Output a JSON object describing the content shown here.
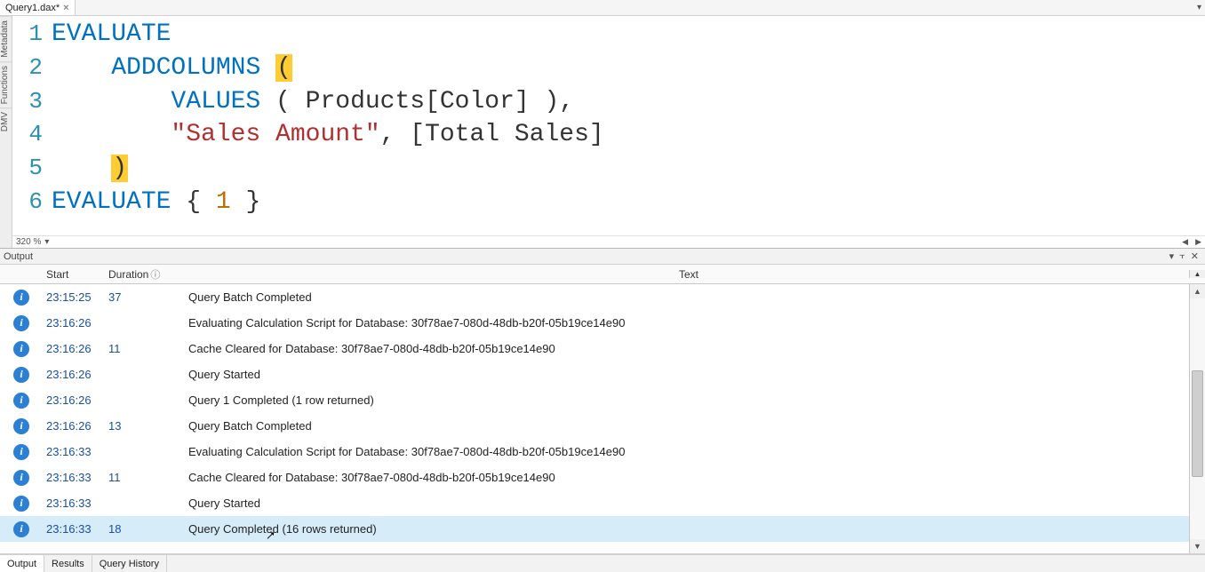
{
  "tabs": {
    "file": "Query1.dax*",
    "close_glyph": "×"
  },
  "side_panels": [
    "Metadata",
    "Functions",
    "DMV"
  ],
  "editor": {
    "zoom_label": "320 %",
    "lines": [
      {
        "n": 1,
        "tokens": [
          {
            "t": "EVALUATE",
            "c": "tok-kw"
          }
        ]
      },
      {
        "n": 2,
        "tokens": [
          {
            "t": "    ",
            "c": ""
          },
          {
            "t": "ADDCOLUMNS",
            "c": "tok-func"
          },
          {
            "t": " ",
            "c": ""
          },
          {
            "t": "(",
            "c": "tok-paren-hi"
          }
        ]
      },
      {
        "n": 3,
        "tokens": [
          {
            "t": "        ",
            "c": ""
          },
          {
            "t": "VALUES",
            "c": "tok-func"
          },
          {
            "t": " ( Products[Color] ),",
            "c": "tok-ident"
          }
        ]
      },
      {
        "n": 4,
        "tokens": [
          {
            "t": "        ",
            "c": ""
          },
          {
            "t": "\"Sales Amount\"",
            "c": "tok-str"
          },
          {
            "t": ", [Total Sales]",
            "c": "tok-ident"
          }
        ]
      },
      {
        "n": 5,
        "tokens": [
          {
            "t": "    ",
            "c": ""
          },
          {
            "t": ")",
            "c": "tok-paren-hi"
          }
        ]
      },
      {
        "n": 6,
        "tokens": [
          {
            "t": "EVALUATE",
            "c": "tok-kw"
          },
          {
            "t": " { ",
            "c": "tok-ident"
          },
          {
            "t": "1",
            "c": "tok-num"
          },
          {
            "t": " }",
            "c": "tok-ident"
          }
        ]
      }
    ]
  },
  "output": {
    "title": "Output",
    "columns": {
      "start": "Start",
      "duration": "Duration",
      "text": "Text"
    },
    "info_glyph": "i",
    "rows": [
      {
        "start": "23:15:25",
        "dur": "37",
        "text": "Query Batch Completed"
      },
      {
        "start": "23:16:26",
        "dur": "",
        "text": "Evaluating Calculation Script for Database: 30f78ae7-080d-48db-b20f-05b19ce14e90"
      },
      {
        "start": "23:16:26",
        "dur": "11",
        "text": "Cache Cleared for Database: 30f78ae7-080d-48db-b20f-05b19ce14e90"
      },
      {
        "start": "23:16:26",
        "dur": "",
        "text": "Query Started"
      },
      {
        "start": "23:16:26",
        "dur": "",
        "text": "Query 1 Completed (1 row returned)"
      },
      {
        "start": "23:16:26",
        "dur": "13",
        "text": "Query Batch Completed"
      },
      {
        "start": "23:16:33",
        "dur": "",
        "text": "Evaluating Calculation Script for Database: 30f78ae7-080d-48db-b20f-05b19ce14e90"
      },
      {
        "start": "23:16:33",
        "dur": "11",
        "text": "Cache Cleared for Database: 30f78ae7-080d-48db-b20f-05b19ce14e90"
      },
      {
        "start": "23:16:33",
        "dur": "",
        "text": "Query Started"
      },
      {
        "start": "23:16:33",
        "dur": "18",
        "text": "Query Completed (16 rows returned)",
        "selected": true
      }
    ]
  },
  "bottom_tabs": [
    "Output",
    "Results",
    "Query History"
  ],
  "glyphs": {
    "dropdown": "▾",
    "pin": "⇧",
    "close": "✕",
    "info_circle": "ⓘ",
    "up": "▲",
    "down": "▼",
    "left": "◀",
    "right": "▶"
  }
}
